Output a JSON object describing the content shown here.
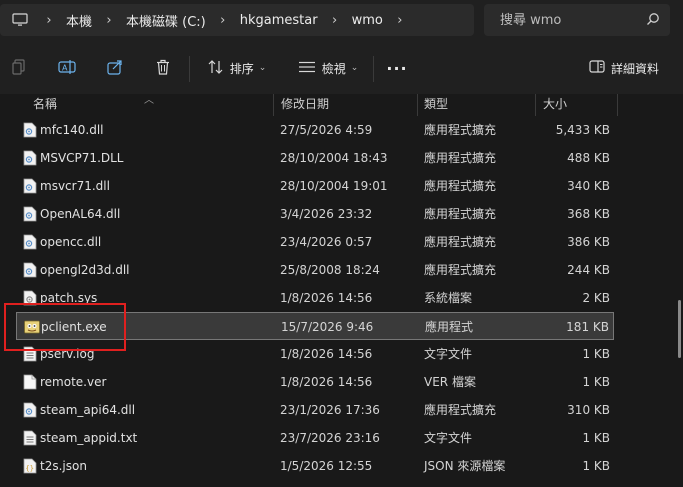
{
  "address": {
    "breadcrumbs": [
      "本機",
      "本機磁碟 (C:)",
      "hkgamestar",
      "wmo"
    ]
  },
  "search": {
    "placeholder": "搜尋 wmo"
  },
  "toolbar": {
    "sort_label": "排序",
    "view_label": "檢視",
    "more_label": "···",
    "details_label": "詳細資料"
  },
  "columns": {
    "name": "名稱",
    "date": "修改日期",
    "type": "類型",
    "size": "大小"
  },
  "files": [
    {
      "name": "mfc140.dll",
      "date": "27/5/2026 4:59",
      "type": "應用程式擴充",
      "size": "5,433 KB",
      "icon": "dll-icon"
    },
    {
      "name": "MSVCP71.DLL",
      "date": "28/10/2004 18:43",
      "type": "應用程式擴充",
      "size": "488 KB",
      "icon": "dll-icon"
    },
    {
      "name": "msvcr71.dll",
      "date": "28/10/2004 19:01",
      "type": "應用程式擴充",
      "size": "340 KB",
      "icon": "dll-icon"
    },
    {
      "name": "OpenAL64.dll",
      "date": "3/4/2026 23:32",
      "type": "應用程式擴充",
      "size": "368 KB",
      "icon": "dll-icon"
    },
    {
      "name": "opencc.dll",
      "date": "23/4/2026 0:57",
      "type": "應用程式擴充",
      "size": "386 KB",
      "icon": "dll-icon"
    },
    {
      "name": "opengl2d3d.dll",
      "date": "25/8/2008 18:24",
      "type": "應用程式擴充",
      "size": "244 KB",
      "icon": "dll-icon"
    },
    {
      "name": "patch.sys",
      "date": "1/8/2026 14:56",
      "type": "系統檔案",
      "size": "2 KB",
      "icon": "sys-icon"
    },
    {
      "name": "pclient.exe",
      "date": "15/7/2026 9:46",
      "type": "應用程式",
      "size": "181 KB",
      "icon": "exe-icon",
      "selected": true
    },
    {
      "name": "pserv.log",
      "date": "1/8/2026 14:56",
      "type": "文字文件",
      "size": "1 KB",
      "icon": "text-file-icon"
    },
    {
      "name": "remote.ver",
      "date": "1/8/2026 14:56",
      "type": "VER 檔案",
      "size": "1 KB",
      "icon": "blank-file-icon"
    },
    {
      "name": "steam_api64.dll",
      "date": "23/1/2026 17:36",
      "type": "應用程式擴充",
      "size": "310 KB",
      "icon": "dll-icon"
    },
    {
      "name": "steam_appid.txt",
      "date": "23/7/2026 23:16",
      "type": "文字文件",
      "size": "1 KB",
      "icon": "text-file-icon"
    },
    {
      "name": "t2s.json",
      "date": "1/5/2026 12:55",
      "type": "JSON 來源檔案",
      "size": "1 KB",
      "icon": "json-file-icon"
    }
  ],
  "colors": {
    "background": "#191919",
    "chrome": "#202020",
    "selection": "#3a3a3a",
    "highlight": "#e0201f",
    "accent": "#4aa3df"
  }
}
